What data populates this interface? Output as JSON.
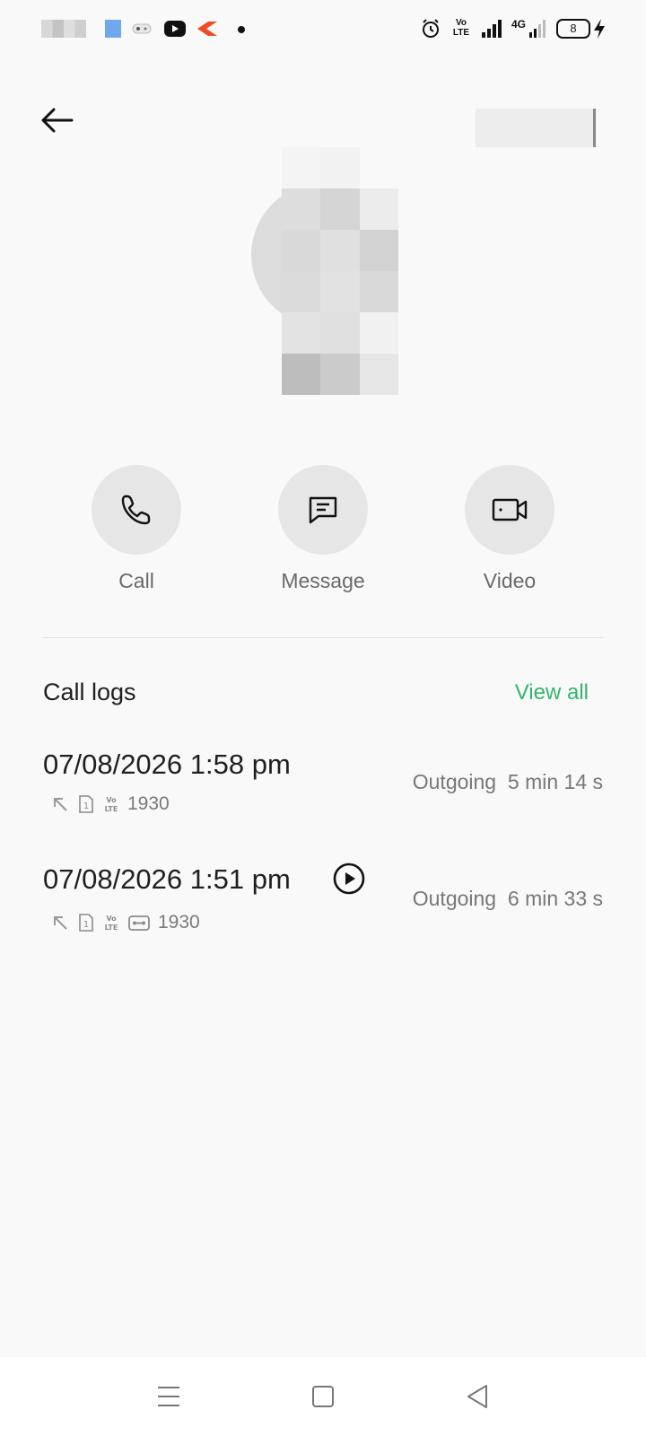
{
  "status_bar": {
    "battery_level": "8",
    "network_label": "4G",
    "volte_label": "Vo LTE"
  },
  "header": {
    "back_icon": "arrow-left-icon"
  },
  "actions": {
    "call_label": "Call",
    "message_label": "Message",
    "video_label": "Video"
  },
  "call_logs": {
    "title": "Call logs",
    "view_all_label": "View all",
    "accent_color": "#35b56b",
    "entries": [
      {
        "datetime": "07/08/2026 1:58 pm",
        "number": "1930",
        "type": "Outgoing",
        "duration": "5 min 14 s",
        "has_recording": false
      },
      {
        "datetime": "07/08/2026 1:51 pm",
        "number": "1930",
        "type": "Outgoing",
        "duration": "6 min 33 s",
        "has_recording": true
      }
    ]
  },
  "nav": {
    "menu_icon": "menu-icon",
    "home_icon": "home-square-icon",
    "back_icon": "back-triangle-icon"
  }
}
